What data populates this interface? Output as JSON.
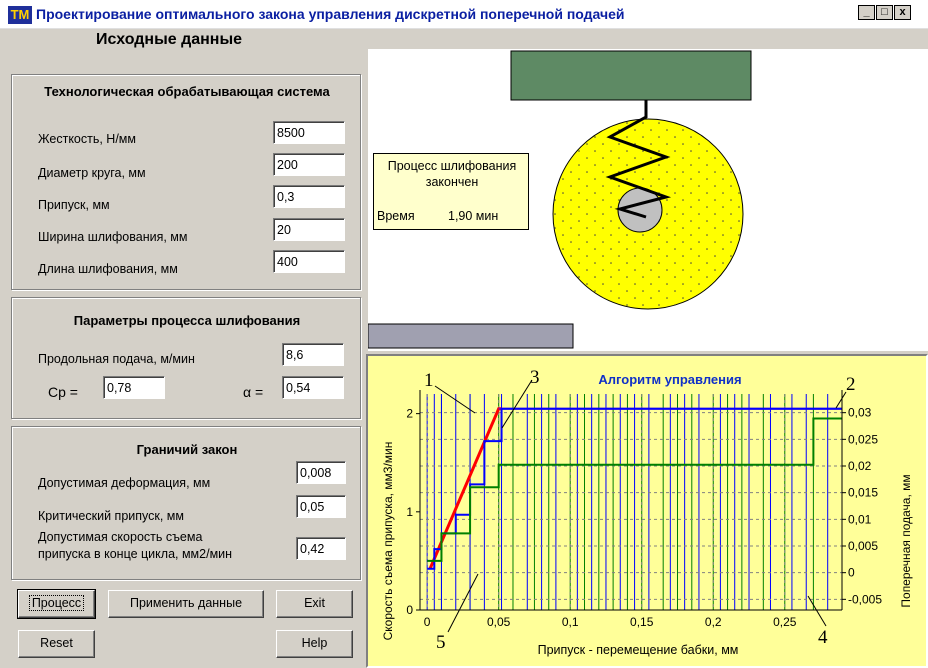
{
  "window": {
    "title": "Проектирование оптимального закона управления дискретной поперечной подачей",
    "min_label": "_",
    "max_label": "□",
    "close_label": "x",
    "icon_text": "TM"
  },
  "heading": "Исходные данные",
  "tech_system": {
    "title": "Технологическая обрабатывающая система",
    "fields": [
      {
        "label": "Жесткость, Н/мм",
        "value": "8500"
      },
      {
        "label": "Диаметр круга, мм",
        "value": "200"
      },
      {
        "label": "Припуск, мм",
        "value": "0,3"
      },
      {
        "label": "Ширина шлифования, мм",
        "value": "20"
      },
      {
        "label": "Длина шлифования, мм",
        "value": "400"
      }
    ]
  },
  "process_params": {
    "title": "Параметры процесса шлифования",
    "feed_label": "Продольная подача, м/мин",
    "feed_value": "8,6",
    "cp_label": "Cp =",
    "cp_value": "0,78",
    "alpha_label": "α =",
    "alpha_value": "0,54"
  },
  "boundary_law": {
    "title": "Граничий закон",
    "deform_label": "Допустимая деформация, мм",
    "deform_value": "0,008",
    "crit_label": "Критический припуск, мм",
    "crit_value": "0,05",
    "speed_label_1": "Допустимая скорость съема",
    "speed_label_2": "припуска в конце цикла, мм2/мин",
    "speed_value": "0,42"
  },
  "buttons": {
    "process": "Процесс",
    "apply": "Применить данные",
    "exit": "Exit",
    "reset": "Reset",
    "help": "Help"
  },
  "simulation": {
    "status_line1": "Процесс шлифования",
    "status_line2": "закончен",
    "time_label": "Время",
    "time_value": "1,90 мин",
    "colors": {
      "carriage": "#5e8a64",
      "wheel": "#ffff00",
      "hub": "#c0c0c0",
      "table": "#a0a0b0",
      "status_bg": "#ffffcc"
    }
  },
  "chart_data": {
    "type": "line",
    "title": "Алгоритм управления",
    "xlabel": "Припуск - перемещение бабки, мм",
    "ylabel_left": "Скорость съема припуска, мм3/мин",
    "ylabel_right": "Поперечная подача, мм",
    "xlim": [
      -0.005,
      0.29
    ],
    "ylim_left": [
      0,
      2.2
    ],
    "ylim_right": [
      -0.007,
      0.0335
    ],
    "x_ticks": [
      "0",
      "0,05",
      "0,1",
      "0,15",
      "0,2",
      "0,25"
    ],
    "x_tick_values": [
      0,
      0.05,
      0.1,
      0.15,
      0.2,
      0.25
    ],
    "y_left_ticks": [
      "0",
      "1",
      "2"
    ],
    "y_left_tick_values": [
      0,
      1,
      2
    ],
    "y_right_ticks": [
      "-0,005",
      "0",
      "0,005",
      "0,01",
      "0,015",
      "0,02",
      "0,025",
      "0,03"
    ],
    "y_right_tick_values": [
      -0.005,
      0,
      0.005,
      0.01,
      0.015,
      0.02,
      0.025,
      0.03
    ],
    "grid": true,
    "background": "#ffff99",
    "curve_labels": [
      "1",
      "2",
      "3",
      "4",
      "5"
    ],
    "series": [
      {
        "color": "#ff0000",
        "axis": "left",
        "x": [
          0.002,
          0.05,
          0.052
        ],
        "y": [
          0.42,
          2.05,
          2.05
        ]
      },
      {
        "color": "#8000c0",
        "axis": "left",
        "x": [
          0.05,
          0.29
        ],
        "y": [
          2.05,
          2.05
        ]
      },
      {
        "color": "#0000ff",
        "axis": "left",
        "x": [
          0.0,
          0.005,
          0.005,
          0.01,
          0.01,
          0.02,
          0.02,
          0.03,
          0.03,
          0.04,
          0.04,
          0.052,
          0.052,
          0.29
        ],
        "y": [
          0.42,
          0.42,
          0.62,
          0.62,
          0.78,
          0.78,
          0.97,
          0.97,
          1.28,
          1.28,
          1.72,
          1.72,
          2.05,
          2.05
        ]
      },
      {
        "color": "#008000",
        "axis": "left",
        "x": [
          0.0,
          0.01,
          0.01,
          0.03,
          0.03,
          0.05,
          0.05,
          0.27,
          0.27,
          0.29
        ],
        "y": [
          0.5,
          0.5,
          0.78,
          0.78,
          1.25,
          1.25,
          1.48,
          1.48,
          1.95,
          1.95
        ]
      }
    ],
    "vlines_blue_x": [
      0.0,
      0.005,
      0.01,
      0.02,
      0.03,
      0.04,
      0.052,
      0.07,
      0.08,
      0.09,
      0.105,
      0.115,
      0.125,
      0.135,
      0.145,
      0.155,
      0.17,
      0.18,
      0.19,
      0.205,
      0.215,
      0.225,
      0.24,
      0.255,
      0.265,
      0.28
    ],
    "vlines_green_x": [
      0.01,
      0.03,
      0.05,
      0.06,
      0.075,
      0.085,
      0.1,
      0.11,
      0.12,
      0.13,
      0.14,
      0.15,
      0.165,
      0.175,
      0.185,
      0.2,
      0.21,
      0.22,
      0.235,
      0.25,
      0.27
    ]
  }
}
